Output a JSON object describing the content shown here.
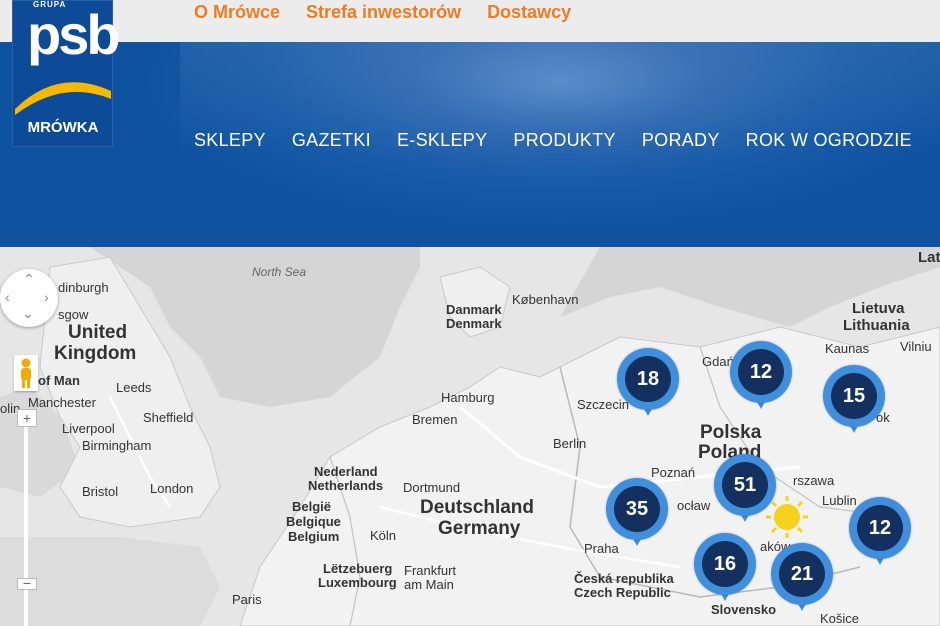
{
  "top_links": [
    "O Mrówce",
    "Strefa inwestorów",
    "Dostawcy"
  ],
  "logo": {
    "group_text": "GRUPA",
    "brand": "psb",
    "name": "MRÓWKA"
  },
  "main_nav": [
    "SKLEPY",
    "GAZETKI",
    "E-SKLEPY",
    "PRODUKTY",
    "PORADY",
    "ROK W OGRODZIE"
  ],
  "map": {
    "labels": {
      "north_sea": "North Sea",
      "edinburgh": "dinburgh",
      "glasgow": "sgow",
      "uk_1": "United",
      "uk_2": "Kingdom",
      "isle_of_man": "of Man",
      "leeds": "Leeds",
      "manchester": "Manchester",
      "sheffield": "Sheffield",
      "dublin": "olin",
      "liverpool": "Liverpool",
      "birmingham": "Birmingham",
      "bristol": "Bristol",
      "london": "London",
      "paris": "Paris",
      "danmark": "Danmark",
      "denmark": "Denmark",
      "kobenhavn": "København",
      "hamburg": "Hamburg",
      "bremen": "Bremen",
      "nederland": "Nederland",
      "netherlands": "Netherlands",
      "dortmund": "Dortmund",
      "belgie": "België",
      "belgique": "Belgique",
      "belgium": "Belgium",
      "koln": "Köln",
      "deutschland": "Deutschland",
      "germany": "Germany",
      "letzebuerg": "Lëtzebuerg",
      "luxembourg": "Luxembourg",
      "frankfurt_1": "Frankfurt",
      "frankfurt_2": "am Main",
      "berlin": "Berlin",
      "szczecin": "Szczecin",
      "gdansk": "Gdań",
      "polska": "Polska",
      "poland": "Poland",
      "poznan": "Poznań",
      "wroclaw": "ocław",
      "warszawa": "rszawa",
      "lublin": "Lublin",
      "bialystok": "ok",
      "praha": "Praha",
      "ceska": "Česká republika",
      "czech": "Czech Republic",
      "krakow": "aków",
      "slovensko": "Slovensko",
      "kosice": "Košice",
      "lietuva": "Lietuva",
      "lithuania": "Lithuania",
      "kaunas": "Kaunas",
      "vilnius": "Vilniu",
      "latvia": "Lat"
    },
    "markers": [
      18,
      12,
      15,
      51,
      35,
      12,
      16,
      21
    ],
    "zoom_in": "+",
    "zoom_out": "−"
  }
}
